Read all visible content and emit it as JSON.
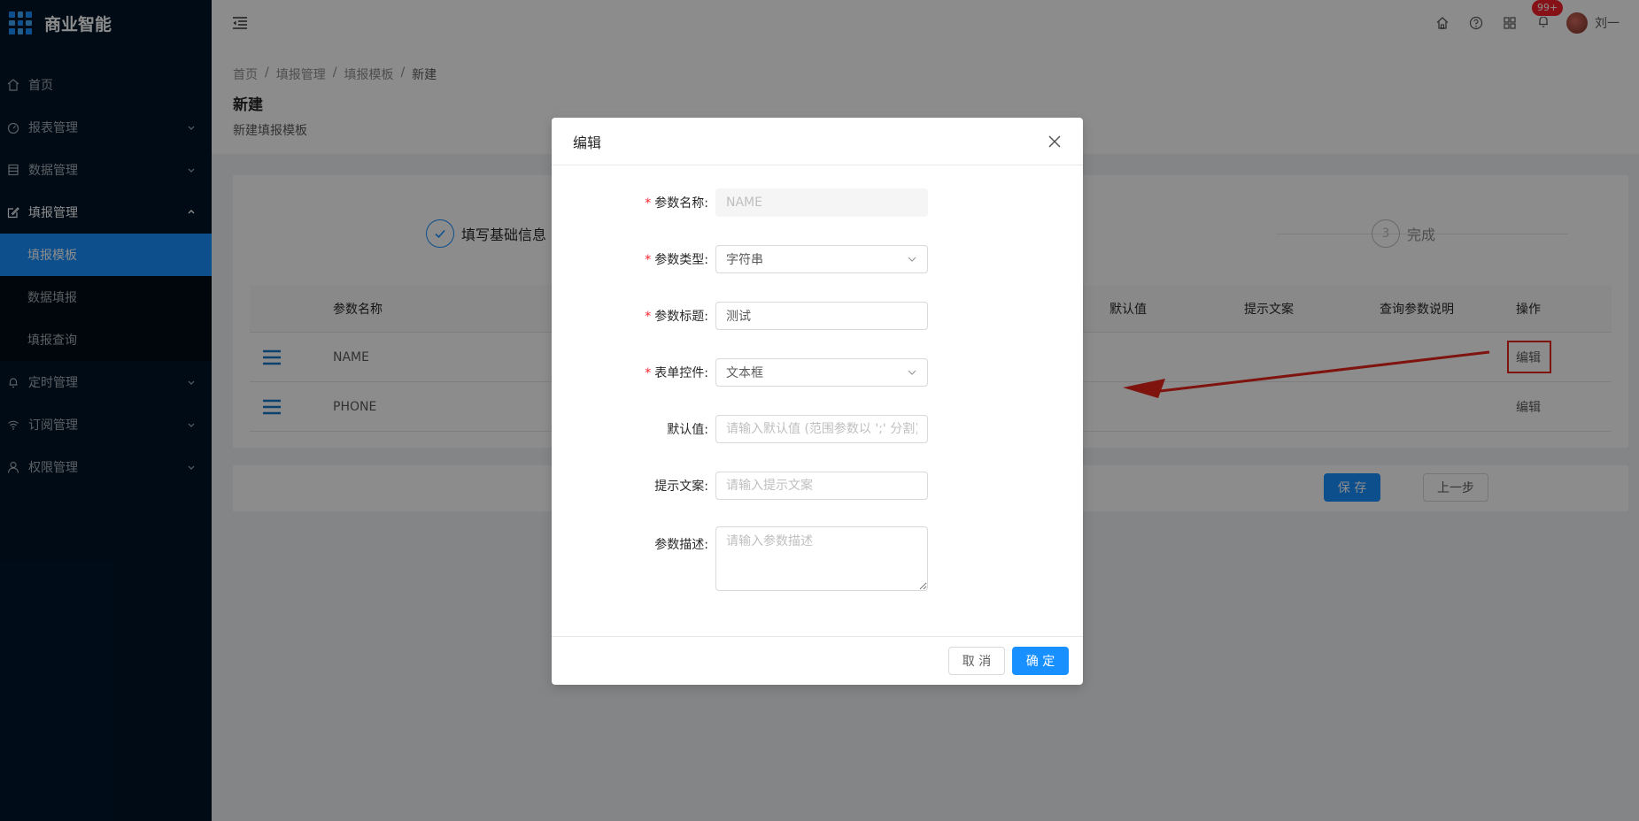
{
  "app": {
    "title": "商业智能"
  },
  "sidebar": {
    "items": [
      {
        "label": "首页",
        "icon": "home-icon"
      },
      {
        "label": "报表管理",
        "icon": "dashboard-icon"
      },
      {
        "label": "数据管理",
        "icon": "database-icon"
      },
      {
        "label": "填报管理",
        "icon": "form-edit-icon"
      },
      {
        "label": "定时管理",
        "icon": "bell-icon"
      },
      {
        "label": "订阅管理",
        "icon": "wifi-icon"
      },
      {
        "label": "权限管理",
        "icon": "user-icon"
      }
    ],
    "submenu": [
      {
        "label": "填报模板"
      },
      {
        "label": "数据填报"
      },
      {
        "label": "填报查询"
      }
    ]
  },
  "header": {
    "badge": "99+",
    "username": "刘一"
  },
  "breadcrumb": [
    "首页",
    "填报管理",
    "填报模板",
    "新建"
  ],
  "page": {
    "title": "新建",
    "description": "新建填报模板"
  },
  "steps": [
    {
      "title": "填写基础信息",
      "status": "finish"
    },
    {
      "number": "3",
      "title": "完成",
      "status": "wait"
    }
  ],
  "table": {
    "columns": [
      "参数名称",
      "默认值",
      "提示文案",
      "查询参数说明",
      "操作"
    ],
    "rows": [
      {
        "name": "NAME",
        "action": "编辑"
      },
      {
        "name": "PHONE",
        "action": "编辑"
      }
    ]
  },
  "footer": {
    "save": "保 存",
    "prev": "上一步"
  },
  "modal": {
    "title": "编辑",
    "fields": {
      "param_name": {
        "label": "参数名称:",
        "placeholder": "NAME"
      },
      "param_type": {
        "label": "参数类型:",
        "value": "字符串"
      },
      "param_title": {
        "label": "参数标题:",
        "value": "测试"
      },
      "form_control": {
        "label": "表单控件:",
        "value": "文本框"
      },
      "default_value": {
        "label": "默认值:",
        "placeholder": "请输入默认值 (范围参数以 ';' 分割)"
      },
      "hint": {
        "label": "提示文案:",
        "placeholder": "请输入提示文案"
      },
      "description": {
        "label": "参数描述:",
        "placeholder": "请输入参数描述"
      }
    },
    "cancel": "取 消",
    "ok": "确 定"
  },
  "colors": {
    "primary": "#1890ff",
    "sidebar": "#001529",
    "annotation": "#e8231b"
  }
}
